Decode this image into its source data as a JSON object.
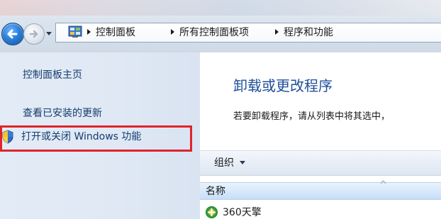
{
  "breadcrumb": {
    "items": [
      "控制面板",
      "所有控制面板项",
      "程序和功能"
    ]
  },
  "icons": {
    "back": "back-arrow-icon",
    "forward": "forward-arrow-icon",
    "history": "chevron-down-icon",
    "address": "control-panel-icon",
    "separator": "chevron-right-icon",
    "feature": "uac-shield-icon",
    "app": "360-app-icon",
    "sort": "sort-ascending-icon"
  },
  "sidebar": {
    "home": "控制面板主页",
    "installed_updates": "查看已安装的更新",
    "windows_features": "打开或关闭 Windows 功能"
  },
  "main": {
    "title": "卸载或更改程序",
    "description": "若要卸载程序，请从列表中将其选中，"
  },
  "toolbar": {
    "organize": "组织"
  },
  "list": {
    "columns": [
      "名称"
    ],
    "rows": [
      {
        "name": "360天擎"
      }
    ]
  },
  "colors": {
    "highlight": "#e0242b",
    "title": "#1f4f99",
    "link": "#143d6e"
  }
}
